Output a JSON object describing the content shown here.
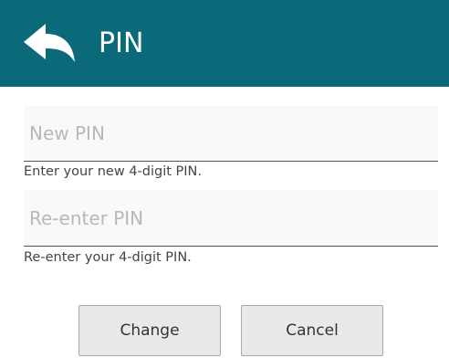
{
  "header": {
    "title": "PIN",
    "back_icon": "back-arrow-icon",
    "background_color": "#0b6a7a"
  },
  "form": {
    "new_pin": {
      "placeholder": "New PIN",
      "value": "",
      "hint": "Enter your new 4-digit PIN."
    },
    "reenter_pin": {
      "placeholder": "Re-enter PIN",
      "value": "",
      "hint": "Re-enter your 4-digit PIN."
    }
  },
  "actions": {
    "change_label": "Change",
    "cancel_label": "Cancel"
  }
}
